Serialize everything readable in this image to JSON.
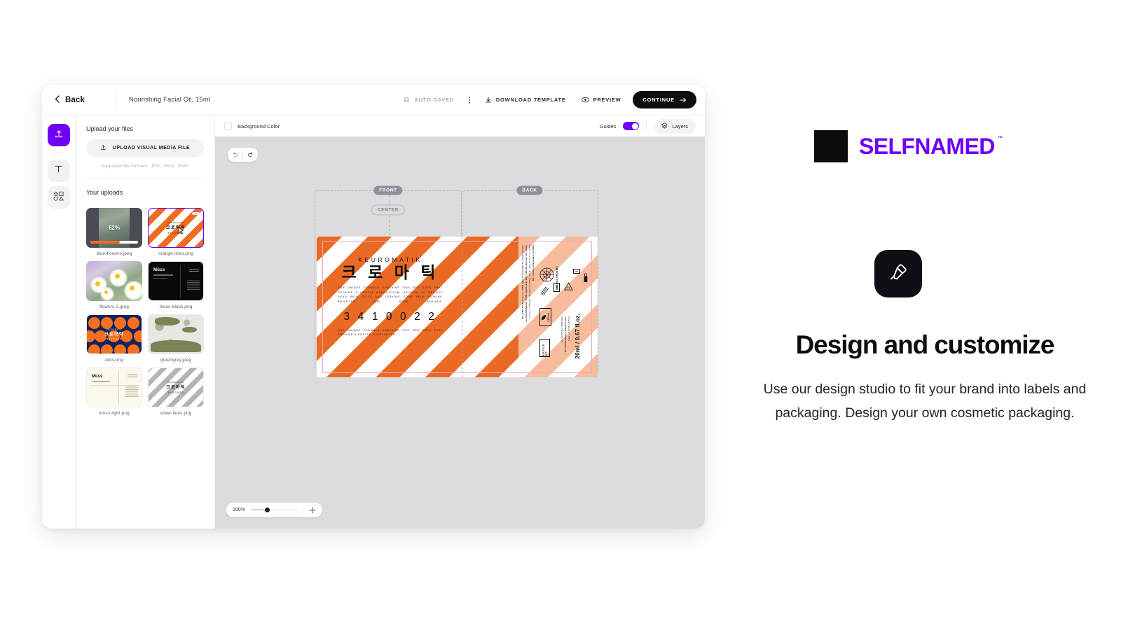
{
  "topbar": {
    "back_label": "Back",
    "back_icon": "chevron-left-icon",
    "product_name": "Nourishing Facial Oil, 15ml",
    "autosaved_label": "AUTO-SAVED",
    "autosaved_icon": "save-cloud-icon",
    "kebab_icon": "more-vertical-icon",
    "download_label": "DOWNLOAD TEMPLATE",
    "download_icon": "download-icon",
    "preview_label": "PREVIEW",
    "preview_icon": "eye-icon",
    "continue_label": "CONTINUE",
    "continue_icon": "arrow-right-icon"
  },
  "rail": {
    "items": [
      {
        "name": "upload",
        "icon": "upload-icon",
        "active": true
      },
      {
        "name": "text",
        "icon": "text-t-icon",
        "active": false
      },
      {
        "name": "shapes",
        "icon": "shapes-icon",
        "active": false
      }
    ]
  },
  "panel": {
    "upload_heading": "Upload your files",
    "upload_button": "UPLOAD VISUAL MEDIA FILE",
    "upload_button_icon": "upload-icon",
    "formats_hint": "Supported file formats: .JPG; .PNG; .SVG.",
    "uploads_heading": "Your uploads",
    "uploads": [
      {
        "name": "blue-flowers.jpeg",
        "state": "uploading",
        "progress": "62%",
        "selected": false
      },
      {
        "name": "orange-lines.png",
        "state": "ready",
        "selected": true
      },
      {
        "name": "flowers-2.jpeg",
        "state": "ready",
        "selected": false
      },
      {
        "name": "muss-black.png",
        "state": "ready",
        "selected": false
      },
      {
        "name": "dots.png",
        "state": "ready",
        "selected": false
      },
      {
        "name": "greengrey.jpeg",
        "state": "ready",
        "selected": false
      },
      {
        "name": "muss-light.png",
        "state": "ready",
        "selected": false
      },
      {
        "name": "silver-lines.png",
        "state": "ready",
        "selected": false
      }
    ]
  },
  "canvas_bar": {
    "background_color_label": "Background Color",
    "background_color_checked": false,
    "guides_label": "Guides",
    "guides_on": true,
    "layers_label": "Layers",
    "layers_icon": "layers-icon"
  },
  "history": {
    "undo_icon": "undo-icon",
    "redo_icon": "redo-icon"
  },
  "zoom_control": {
    "level": "100%",
    "pan_icon": "move-icon"
  },
  "artboard": {
    "front_badge": "FRONT",
    "back_badge": "BACK",
    "center_badge": "CENTER"
  },
  "label": {
    "brand_en": "KEUROMATIK",
    "brand_ko": "크 로 마 틱",
    "copy_1": "OUR UNIQUE FORMULA CONTAINS TINY RED DOTS THAT PROVIDE A GENTLE EXFOLIATION, HELPING TO REMOVE DEAD SKIN CELLS AND LEAVING YOUR SKIN LOOKING BRIGHTER AND MORE RADIANT.",
    "code": "3 4 1 0 0 2 2",
    "copy_2": "OUR UNIQUE FORMULA CONTAINS TINY RED DOTS THAT PROVIDE A GENTLE EXFOLIATION.",
    "back": {
      "ingredients_line_1": "EN / CBD Oil Booster  LV / CBD eļļas koncentrāts  FI / Hiuli booster",
      "ingredients_line_2": "au CBD  NO/SE/DK / CBD-oljebooster  DE / CBD Öl-Booster  FR / Huile",
      "ingredients_line_3": "booster au CBD  NL / Booster met CBD-olie  IT / Olio Booster con CBD",
      "ingredients_line_4": "ES / Aceite potenciador de CBD",
      "vegan_label": "VEGAN",
      "recycle_label": "RECYCLE PET",
      "cosmos_label": "COSMOS ORGANIC",
      "period_after_opening": "3M",
      "batch_line_1": "EU CPNP No: 38543249",
      "batch_line_2": "SIA NORD Beauty, Bakkora 20a,",
      "batch_line_3": "Riga, LV-1048, LATVIA",
      "volume": "20ml / 0.67 fl.oz."
    }
  },
  "marketing": {
    "brand_name": "SELFNAMED",
    "brand_tm": "™",
    "brand_color": "#6d00f5",
    "blob_icon": "selfnamed-blob-logo-icon",
    "feature_icon": "paintbrush-icon",
    "headline": "Design and customize",
    "subcopy": "Use our design studio to fit your brand into labels and packaging. Design your own cosmetic packaging."
  }
}
